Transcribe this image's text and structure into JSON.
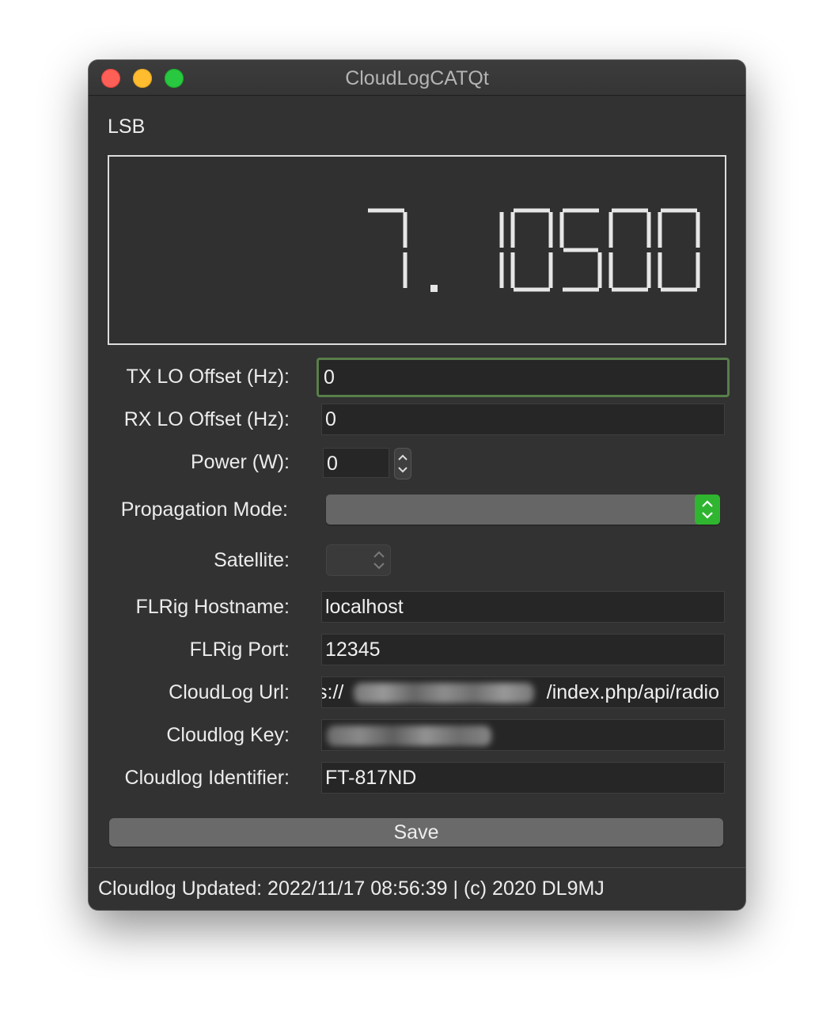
{
  "window": {
    "title": "CloudLogCATQt"
  },
  "radio": {
    "mode": "LSB",
    "frequency_display": "7.10500"
  },
  "form": {
    "tx_lo_offset_label": "TX LO Offset (Hz):",
    "tx_lo_offset_value": "0",
    "rx_lo_offset_label": "RX LO Offset (Hz):",
    "rx_lo_offset_value": "0",
    "power_label": "Power (W):",
    "power_value": "0",
    "propagation_mode_label": "Propagation Mode:",
    "propagation_mode_value": "",
    "satellite_label": "Satellite:",
    "satellite_value": "",
    "flrig_hostname_label": "FLRig Hostname:",
    "flrig_hostname_value": "localhost",
    "flrig_port_label": "FLRig Port:",
    "flrig_port_value": "12345",
    "cloudlog_url_label": "CloudLog Url:",
    "cloudlog_url_prefix": "s://",
    "cloudlog_url_suffix": "/index.php/api/radio",
    "cloudlog_key_label": "Cloudlog Key:",
    "cloudlog_identifier_label": "Cloudlog Identifier:",
    "cloudlog_identifier_value": "FT-817ND",
    "save_label": "Save"
  },
  "status": {
    "text": "Cloudlog Updated: 2022/11/17 08:56:39 | (c) 2020 DL9MJ"
  },
  "colors": {
    "window_bg": "#323232",
    "accent_green": "#2fb52f",
    "focus_border": "#587f4a",
    "lcd_segment": "#e6e6e6"
  }
}
